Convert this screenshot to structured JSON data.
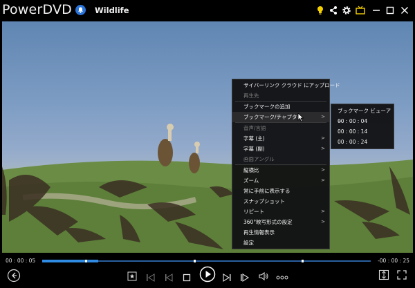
{
  "app": {
    "title": "PowerDVD",
    "media_title": "Wildlife"
  },
  "title_icons": [
    "lightbulb-icon",
    "share-icon",
    "settings-gear-icon",
    "tv-mode-icon"
  ],
  "window_buttons": [
    "minimize",
    "maximize",
    "close"
  ],
  "context_menu": {
    "items": [
      {
        "label": "サイバーリンク クラウド にアップロード",
        "enabled": true,
        "submenu": false
      },
      {
        "label": "再生先",
        "enabled": false,
        "submenu": false
      },
      {
        "label": "ブックマークの追加",
        "enabled": true,
        "submenu": false
      },
      {
        "label": "ブックマーク/チャプター",
        "enabled": true,
        "submenu": true,
        "highlighted": true
      },
      {
        "label": "音声/言語",
        "enabled": false,
        "submenu": false
      },
      {
        "label": "字幕 (主)",
        "enabled": true,
        "submenu": true
      },
      {
        "label": "字幕 (副)",
        "enabled": true,
        "submenu": true
      },
      {
        "label": "画面アングル",
        "enabled": false,
        "submenu": false
      },
      {
        "label": "縦横比",
        "enabled": true,
        "submenu": true
      },
      {
        "label": "ズーム",
        "enabled": true,
        "submenu": true
      },
      {
        "label": "常に手前に表示する",
        "enabled": true,
        "submenu": false
      },
      {
        "label": "スナップショット",
        "enabled": true,
        "submenu": false
      },
      {
        "label": "リピート",
        "enabled": true,
        "submenu": true
      },
      {
        "label": "360°映写形式の設定",
        "enabled": true,
        "submenu": true
      },
      {
        "label": "再生情報表示",
        "enabled": true,
        "submenu": false
      },
      {
        "label": "設定",
        "enabled": true,
        "submenu": false
      }
    ]
  },
  "submenu": {
    "items": [
      "ブックマーク ビューアー",
      "00 : 00 : 04",
      "00 : 00 : 14",
      "00 : 00 : 24"
    ]
  },
  "playback": {
    "current_time": "00 : 00 : 05",
    "remaining_time": "-00 : 00 : 25",
    "progress": 0.17,
    "bookmark_positions": [
      0.13,
      0.46,
      0.79
    ]
  },
  "colors": {
    "accent": "#2f8be3",
    "menu_bg": "#121214",
    "disabled_text": "#7b7b7b"
  }
}
